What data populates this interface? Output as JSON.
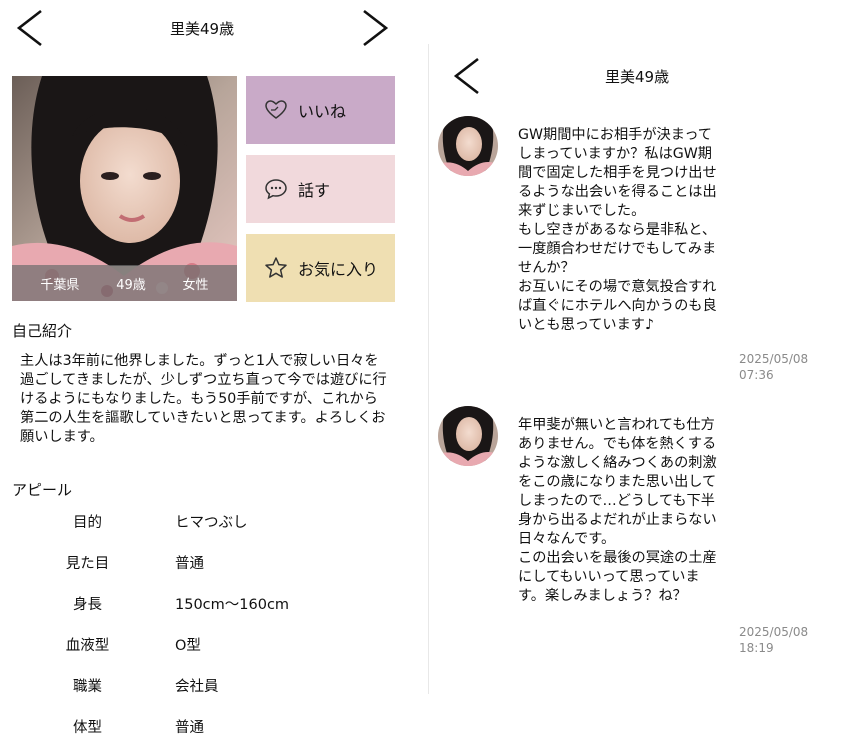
{
  "left": {
    "header": {
      "title": "里美49歳"
    },
    "photo": {
      "prefecture": "千葉県",
      "age": "49歳",
      "gender": "女性"
    },
    "actions": {
      "like_label": "いいね",
      "talk_label": "話す",
      "favorite_label": "お気に入り"
    },
    "intro": {
      "heading": "自己紹介",
      "text": "主人は3年前に他界しました。ずっと1人で寂しい日々を過ごしてきましたが、少しずつ立ち直って今では遊びに行けるようにもなりました。もう50手前ですが、これから第二の人生を謳歌していきたいと思ってます。よろしくお願いします。"
    },
    "appeal": {
      "heading": "アピール",
      "rows": [
        {
          "key": "目的",
          "value": "ヒマつぶし"
        },
        {
          "key": "見た目",
          "value": "普通"
        },
        {
          "key": "身長",
          "value": "150cm〜160cm"
        },
        {
          "key": "血液型",
          "value": "O型"
        },
        {
          "key": "職業",
          "value": "会社員"
        },
        {
          "key": "体型",
          "value": "普通"
        }
      ]
    }
  },
  "right": {
    "header": {
      "title": "里美49歳"
    },
    "messages": [
      {
        "text": "GW期間中にお相手が決まってしまっていますか？私はGW期間で固定した相手を見つけ出せるような出会いを得ることは出来ずじまいでした。\nもし空きがあるなら是非私と、一度顔合わせだけでもしてみませんか？\nお互いにその場で意気投合すれば直ぐにホテルへ向かうのも良いとも思っています♪",
        "time": "2025/05/08\n07:36"
      },
      {
        "text": "年甲斐が無いと言われても仕方ありません。でも体を熱くするような激しく絡みつくあの刺激をこの歳になりまた思い出してしまったので…どうしても下半身から出るよだれが止まらない日々なんです。\nこの出会いを最後の冥途の土産にしてもいいって思っています。楽しみましょう？ね？",
        "time": "2025/05/08\n18:19"
      }
    ]
  },
  "colors": {
    "like_bg": "#c9aac8",
    "talk_bg": "#f1d9dc",
    "favorite_bg": "#efdfb2",
    "timestamp": "#8a8a8a"
  }
}
